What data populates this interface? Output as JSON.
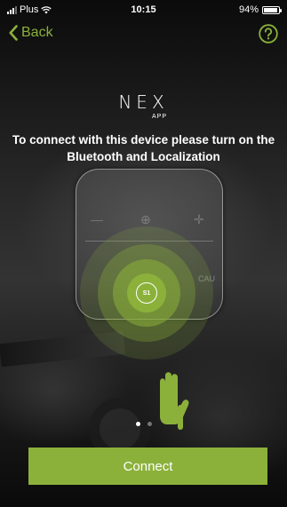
{
  "status_bar": {
    "carrier": "Plus",
    "time": "10:15",
    "battery_percent": "94%",
    "battery_level": 0.94
  },
  "nav": {
    "back_label": "Back",
    "help_icon": "question-circle-icon"
  },
  "logo": {
    "main": "NEX",
    "sub": "APP"
  },
  "instruction": "To connect with this device please turn on the Bluetooth and Localization",
  "device": {
    "button_label": "S1",
    "side_label": "CAU"
  },
  "pagination": {
    "count": 2,
    "active_index": 0
  },
  "connect_label": "Connect",
  "colors": {
    "accent": "#8bb13b",
    "background": "#111111",
    "text": "#ffffff"
  }
}
